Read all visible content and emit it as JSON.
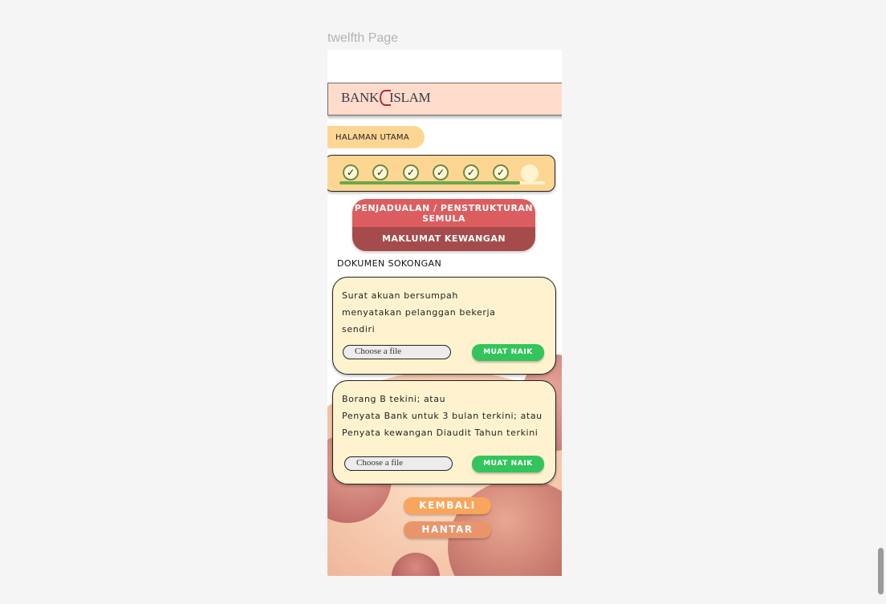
{
  "frame_label": "twelfth Page",
  "header": {
    "logo_text_left": "BANK",
    "logo_text_right": "ISLAM"
  },
  "nav": {
    "home_label": "HALAMAN UTAMA"
  },
  "progress": {
    "completed_steps": 6,
    "total_steps": 7,
    "fill_fraction": 0.88,
    "check_glyph": "✓",
    "colors": {
      "check_ring": "#6e8a43",
      "fill": "#6ba947"
    }
  },
  "section": {
    "title": "PENJADUALAN / PENSTRUKTURAN SEMULA",
    "subtitle": "MAKLUMAT KEWANGAN"
  },
  "documents_heading": "DOKUMEN SOKONGAN",
  "documents": [
    {
      "text": "Surat akuan bersumpah\nmenyatakan pelanggan bekerja\nsendiri",
      "file_placeholder": "Choose a file",
      "upload_label": "MUAT NAIK"
    },
    {
      "text": "Borang B tekini; atau\nPenyata Bank untuk 3 bulan terkini; atau\nPenyata kewangan Diaudit Tahun terkini",
      "file_placeholder": "Choose a file",
      "upload_label": "MUAT NAIK"
    }
  ],
  "actions": {
    "back_label": "KEMBALI",
    "submit_label": "HANTAR"
  },
  "colors": {
    "header_bg": "#ffdccb",
    "pill_bg": "#fed694",
    "section_top": "#dc5d5f",
    "section_bottom": "#a54b4c",
    "upload": "#33c45b",
    "back": "#f9a55c",
    "submit": "#e8956b"
  }
}
